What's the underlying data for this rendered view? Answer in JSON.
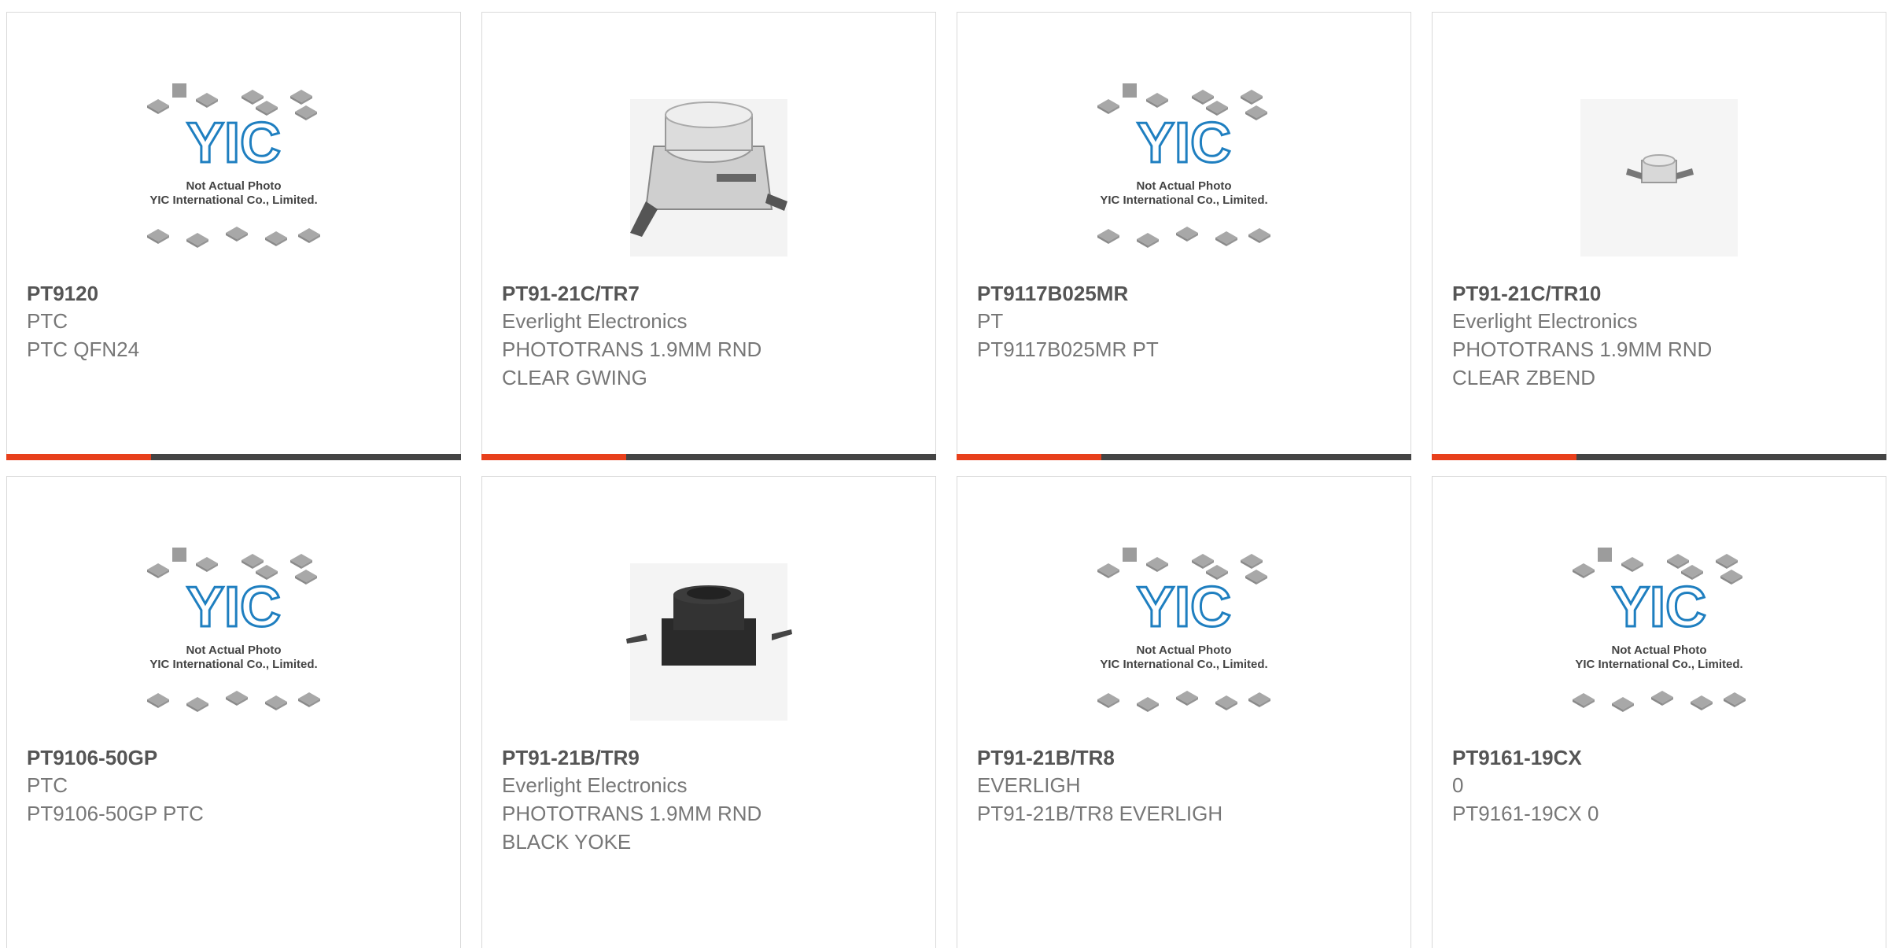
{
  "products": [
    {
      "part": "PT9120",
      "maker": "PTC",
      "description": "PTC QFN24",
      "image": "yic-placeholder"
    },
    {
      "part": "PT91-21C/TR7",
      "maker": "Everlight Electronics",
      "description": "PHOTOTRANS 1.9MM RND\nCLEAR GWING",
      "image": "clear-phototransistor-gwing"
    },
    {
      "part": "PT9117B025MR",
      "maker": "PT",
      "description": "PT9117B025MR PT",
      "image": "yic-placeholder"
    },
    {
      "part": "PT91-21C/TR10",
      "maker": "Everlight Electronics",
      "description": "PHOTOTRANS 1.9MM RND\nCLEAR ZBEND",
      "image": "clear-phototransistor-zbend"
    },
    {
      "part": "PT9106-50GP",
      "maker": "PTC",
      "description": "PT9106-50GP PTC",
      "image": "yic-placeholder"
    },
    {
      "part": "PT91-21B/TR9",
      "maker": "Everlight Electronics",
      "description": "PHOTOTRANS 1.9MM RND\nBLACK YOKE",
      "image": "black-phototransistor-yoke"
    },
    {
      "part": "PT91-21B/TR8",
      "maker": "EVERLIGH",
      "description": "PT91-21B/TR8 EVERLIGH",
      "image": "yic-placeholder"
    },
    {
      "part": "PT9161-19CX",
      "maker": "0",
      "description": "PT9161-19CX 0",
      "image": "yic-placeholder"
    }
  ],
  "placeholder": {
    "logo_text": "YIC",
    "line1": "Not Actual Photo",
    "line2": "YIC International Co., Limited."
  },
  "colors": {
    "accent": "#e8401c",
    "bar": "#444444",
    "logo_blue": "#1f7fc0",
    "part_text": "#555555",
    "meta_text": "#777777"
  }
}
